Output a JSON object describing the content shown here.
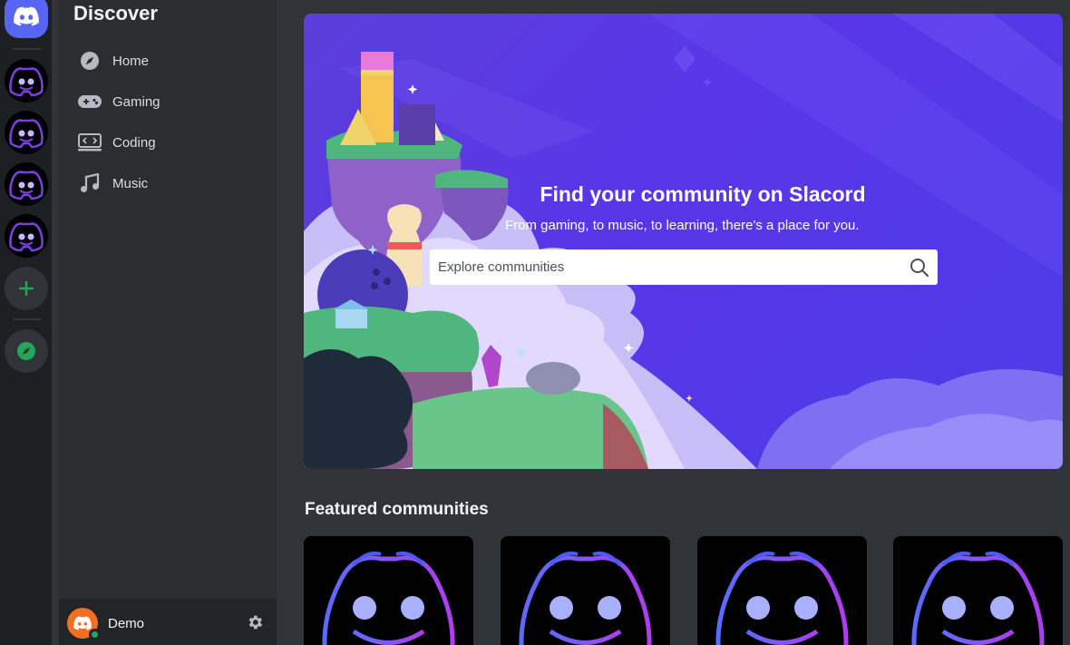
{
  "rail": {
    "home_icon": "discord-logo-icon",
    "servers": [
      {
        "icon": "discord-neon-avatar-icon"
      },
      {
        "icon": "discord-neon-avatar-icon"
      },
      {
        "icon": "discord-neon-avatar-icon"
      },
      {
        "icon": "discord-neon-avatar-icon"
      }
    ],
    "add_icon": "plus-icon",
    "explore_icon": "compass-icon",
    "accent": "#5865f2",
    "green": "#23a55a"
  },
  "sidebar": {
    "title": "Discover",
    "items": [
      {
        "label": "Home",
        "icon": "compass-icon"
      },
      {
        "label": "Gaming",
        "icon": "gamepad-icon"
      },
      {
        "label": "Coding",
        "icon": "code-icon"
      },
      {
        "label": "Music",
        "icon": "music-note-icon"
      }
    ]
  },
  "user": {
    "name": "Demo",
    "status": "online",
    "avatar_color": "#f26f21",
    "settings_icon": "gear-icon"
  },
  "hero": {
    "title": "Find your community on Slacord",
    "subtitle": "From gaming, to music, to learning, there's a place for you.",
    "search_placeholder": "Explore communities",
    "search_icon": "search-icon"
  },
  "featured": {
    "title": "Featured communities",
    "cards": [
      {
        "icon": "discord-neon-avatar-icon"
      },
      {
        "icon": "discord-neon-avatar-icon"
      },
      {
        "icon": "discord-neon-avatar-icon"
      },
      {
        "icon": "discord-neon-avatar-icon"
      }
    ]
  }
}
